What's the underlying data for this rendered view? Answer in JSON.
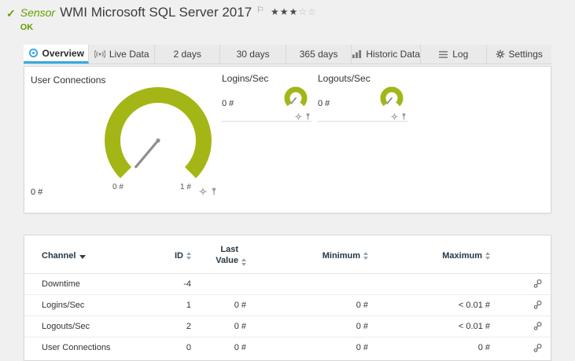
{
  "header": {
    "sensor_label": "Sensor",
    "title": "WMI Microsoft SQL Server 2017",
    "status": "OK",
    "stars_filled": "★★★",
    "stars_empty": "☆☆",
    "flag": "⚐",
    "check": "✓"
  },
  "tabs": [
    {
      "label": "Overview"
    },
    {
      "label": "Live Data"
    },
    {
      "label": "2 days"
    },
    {
      "label": "30 days"
    },
    {
      "label": "365 days"
    },
    {
      "label": "Historic Data"
    },
    {
      "label": "Log"
    },
    {
      "label": "Settings"
    }
  ],
  "gauges": {
    "primary": {
      "title": "User Connections",
      "value": "0 #",
      "scale_min": "0 #",
      "scale_max": "1 #"
    },
    "secondary": [
      {
        "title": "Logins/Sec",
        "value": "0 #"
      },
      {
        "title": "Logouts/Sec",
        "value": "0 #"
      }
    ]
  },
  "table": {
    "headers": {
      "channel": "Channel",
      "id": "ID",
      "last_value": "Last Value",
      "minimum": "Minimum",
      "maximum": "Maximum"
    },
    "rows": [
      {
        "channel": "Downtime",
        "id": "-4",
        "last_value": "",
        "minimum": "",
        "maximum": ""
      },
      {
        "channel": "Logins/Sec",
        "id": "1",
        "last_value": "0 #",
        "minimum": "0 #",
        "maximum": "< 0.01 #"
      },
      {
        "channel": "Logouts/Sec",
        "id": "2",
        "last_value": "0 #",
        "minimum": "0 #",
        "maximum": "< 0.01 #"
      },
      {
        "channel": "User Connections",
        "id": "0",
        "last_value": "0 #",
        "minimum": "0 #",
        "maximum": "0 #"
      }
    ]
  },
  "colors": {
    "gauge_green": "#a3b616",
    "status_green": "#679c00",
    "tab_active_blue": "#36a9e1"
  }
}
